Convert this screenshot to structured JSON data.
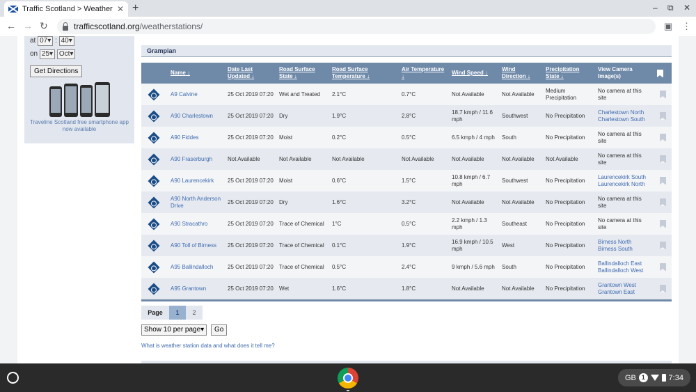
{
  "browser": {
    "tab_title": "Traffic Scotland > Weather Statio",
    "tab_close": "✕",
    "new_tab": "+",
    "url_domain": "trafficscotland.org",
    "url_path": "/weatherstations/",
    "window_controls": [
      "–",
      "⧉",
      "✕"
    ]
  },
  "sidebar": {
    "at_label": "at",
    "hour": "07",
    "minute": "40",
    "on_label": "on",
    "day": "25",
    "month": "Oct",
    "get_directions": "Get Directions",
    "traveline_text": "Traveline Scotland free smartphone app now available"
  },
  "region": "Grampian",
  "table": {
    "headers": [
      "Name",
      "Date Last Updated",
      "Road Surface State",
      "Road Surface Temperature",
      "Air Temperature",
      "Wind Speed",
      "Wind Direction",
      "Precipitation State",
      "View Camera Image(s)"
    ],
    "rows": [
      {
        "name": "A9 Calvine",
        "date": "25 Oct 2019 07:20",
        "road_state": "Wet and Treated",
        "road_temp": "2.1°C",
        "air_temp": "0.7°C",
        "wind_speed": "Not Available",
        "wind_dir": "Not Available",
        "precip": "Medium Precipitation",
        "camera": "No camera at this site",
        "camera_links": []
      },
      {
        "name": "A90 Charlestown",
        "date": "25 Oct 2019 07:20",
        "road_state": "Dry",
        "road_temp": "1.9°C",
        "air_temp": "2.8°C",
        "wind_speed": "18.7 kmph / 11.6 mph",
        "wind_dir": "Southwest",
        "precip": "No Precipitation",
        "camera": "",
        "camera_links": [
          "Charlestown North",
          "Charlestown South"
        ]
      },
      {
        "name": "A90 Fiddes",
        "date": "25 Oct 2019 07:20",
        "road_state": "Moist",
        "road_temp": "0.2°C",
        "air_temp": "0.5°C",
        "wind_speed": "6.5 kmph / 4 mph",
        "wind_dir": "South",
        "precip": "No Precipitation",
        "camera": "No camera at this site",
        "camera_links": []
      },
      {
        "name": "A90 Fraserburgh",
        "date": "Not Available",
        "road_state": "Not Available",
        "road_temp": "Not Available",
        "air_temp": "Not Available",
        "wind_speed": "Not Available",
        "wind_dir": "Not Available",
        "precip": "Not Available",
        "camera": "No camera at this site",
        "camera_links": []
      },
      {
        "name": "A90 Laurencekirk",
        "date": "25 Oct 2019 07:20",
        "road_state": "Moist",
        "road_temp": "0.6°C",
        "air_temp": "1.5°C",
        "wind_speed": "10.8 kmph / 6.7 mph",
        "wind_dir": "Southwest",
        "precip": "No Precipitation",
        "camera": "",
        "camera_links": [
          "Laurencekirk South",
          "Laurencekirk North"
        ]
      },
      {
        "name": "A90 North Anderson Drive",
        "date": "25 Oct 2019 07:20",
        "road_state": "Dry",
        "road_temp": "1.6°C",
        "air_temp": "3.2°C",
        "wind_speed": "Not Available",
        "wind_dir": "Not Available",
        "precip": "No Precipitation",
        "camera": "No camera at this site",
        "camera_links": []
      },
      {
        "name": "A90 Stracathro",
        "date": "25 Oct 2019 07:20",
        "road_state": "Trace of Chemical",
        "road_temp": "1°C",
        "air_temp": "0.5°C",
        "wind_speed": "2.2 kmph / 1.3 mph",
        "wind_dir": "Southeast",
        "precip": "No Precipitation",
        "camera": "No camera at this site",
        "camera_links": []
      },
      {
        "name": "A90 Toll of Birness",
        "date": "25 Oct 2019 07:20",
        "road_state": "Trace of Chemical",
        "road_temp": "0.1°C",
        "air_temp": "1.9°C",
        "wind_speed": "16.9 kmph / 10.5 mph",
        "wind_dir": "West",
        "precip": "No Precipitation",
        "camera": "",
        "camera_links": [
          "Birness North",
          "Birness South"
        ]
      },
      {
        "name": "A95 Ballindalloch",
        "date": "25 Oct 2019 07:20",
        "road_state": "Trace of Chemical",
        "road_temp": "0.5°C",
        "air_temp": "2.4°C",
        "wind_speed": "9 kmph / 5.6 mph",
        "wind_dir": "South",
        "precip": "No Precipitation",
        "camera": "",
        "camera_links": [
          "Ballindalloch East",
          "Ballindalloch West"
        ]
      },
      {
        "name": "A95 Grantown",
        "date": "25 Oct 2019 07:20",
        "road_state": "Wet",
        "road_temp": "1.6°C",
        "air_temp": "1.8°C",
        "wind_speed": "Not Available",
        "wind_dir": "Not Available",
        "precip": "No Precipitation",
        "camera": "",
        "camera_links": [
          "Grantown West",
          "Grantown East"
        ]
      }
    ]
  },
  "pager": {
    "label": "Page",
    "pages": [
      "1",
      "2"
    ],
    "current": "1"
  },
  "page_size": {
    "selected": "Show 10 per page",
    "go": "Go"
  },
  "help_link": "What is weather station data and what does it tell me?",
  "shelf": {
    "locale": "GB",
    "notifications": "1",
    "time": "7:34"
  },
  "colors": {
    "header_bg": "#6f89a8",
    "link": "#3f6bb0",
    "diamond": "#1a4c86"
  }
}
